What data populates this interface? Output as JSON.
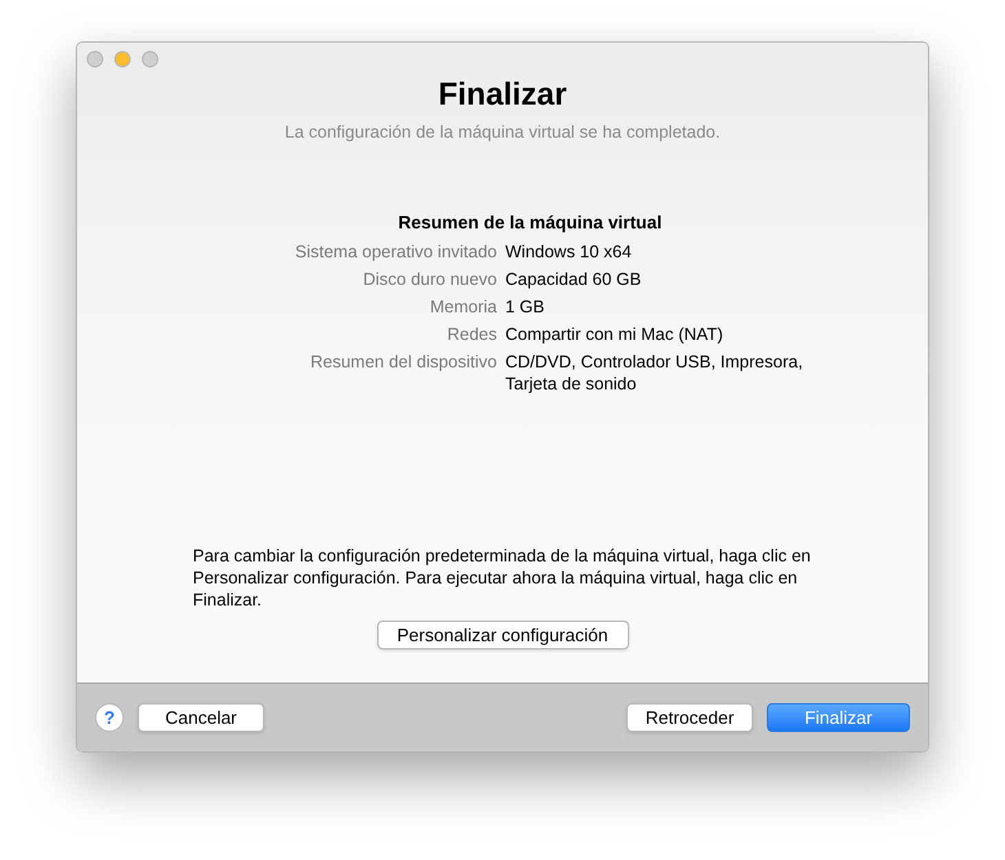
{
  "window": {
    "traffic_lights": [
      {
        "color": "#cfcfcf"
      },
      {
        "color": "#fbbc2e"
      },
      {
        "color": "#cfcfcf"
      }
    ]
  },
  "title": "Finalizar",
  "subtitle": "La configuración de la máquina virtual se ha completado.",
  "summary": {
    "heading": "Resumen de la máquina virtual",
    "rows": [
      {
        "label": "Sistema operativo invitado",
        "value": "Windows 10 x64"
      },
      {
        "label": "Disco duro nuevo",
        "value": "Capacidad 60 GB"
      },
      {
        "label": "Memoria",
        "value": "1 GB"
      },
      {
        "label": "Redes",
        "value": "Compartir con mi Mac (NAT)"
      },
      {
        "label": "Resumen del dispositivo",
        "value": "CD/DVD, Controlador USB, Impresora, Tarjeta de sonido"
      }
    ]
  },
  "note": "Para cambiar la configuración predeterminada de la máquina virtual, haga clic en Personalizar configuración. Para ejecutar ahora la máquina virtual, haga clic en Finalizar.",
  "customize_button": "Personalizar configuración",
  "footer": {
    "help": "?",
    "left_buttons": [
      {
        "label": "Cancelar",
        "default": false
      }
    ],
    "right_buttons": [
      {
        "label": "Retroceder",
        "default": false
      },
      {
        "label": "Finalizar",
        "default": true
      }
    ]
  }
}
